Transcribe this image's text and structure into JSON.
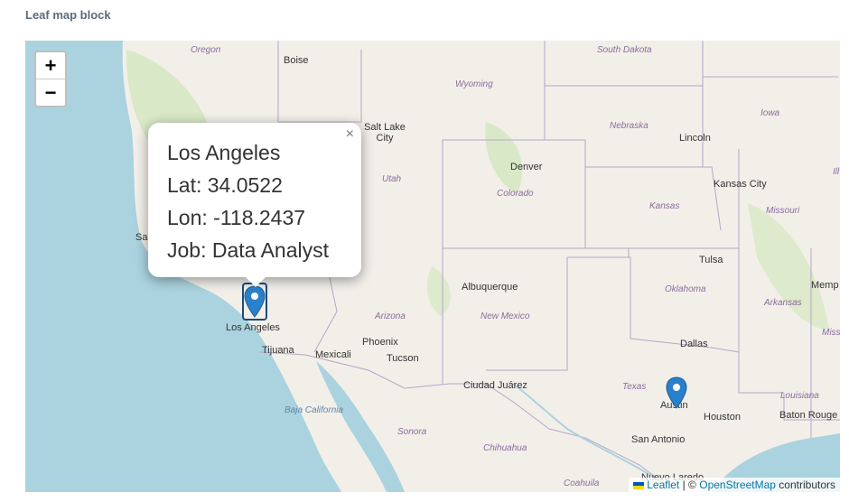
{
  "block": {
    "title": "Leaf map block"
  },
  "map": {
    "zoom": {
      "in_label": "+",
      "out_label": "−"
    },
    "popup": {
      "city": "Los Angeles",
      "lat": "Lat: 34.0522",
      "lon": "Lon: -118.2437",
      "job": "Job: Data Analyst",
      "close": "×"
    },
    "markers": [
      {
        "name": "Los Angeles",
        "lat": 34.0522,
        "lon": -118.2437,
        "selected": true
      },
      {
        "name": "Austin",
        "lat": 30.2672,
        "lon": -97.7431,
        "selected": false
      }
    ],
    "cities": [
      "Boise",
      "Salt Lake City",
      "Denver",
      "Lincoln",
      "Kansas City",
      "Tulsa",
      "Albuquerque",
      "Phoenix",
      "Tucson",
      "Los Angeles",
      "Tijuana",
      "Mexicali",
      "Ciudad Juárez",
      "Dallas",
      "Houston",
      "Austin",
      "San Antonio",
      "Baton Rouge",
      "Memp",
      "Nuevo Laredo",
      "Sa"
    ],
    "regions": [
      "Oregon",
      "Wyoming",
      "South Dakota",
      "Nebraska",
      "Iowa",
      "Utah",
      "Colorado",
      "Kansas",
      "Missouri",
      "Ill",
      "Oklahoma",
      "Arkansas",
      "Arizona",
      "New Mexico",
      "Texas",
      "Louisiana",
      "Missi",
      "Sonora",
      "Chihuahua",
      "Coahuila"
    ],
    "water": [
      "Baja California"
    ],
    "attribution": {
      "leaflet": "Leaflet",
      "sep": "| ©",
      "osm": "OpenStreetMap",
      "suffix": "contributors"
    },
    "colors": {
      "land": "#f2efe9",
      "water": "#aad3df",
      "border": "#b7a6c7",
      "marker": "#2a81cb",
      "green": "#cfe6b8"
    }
  }
}
